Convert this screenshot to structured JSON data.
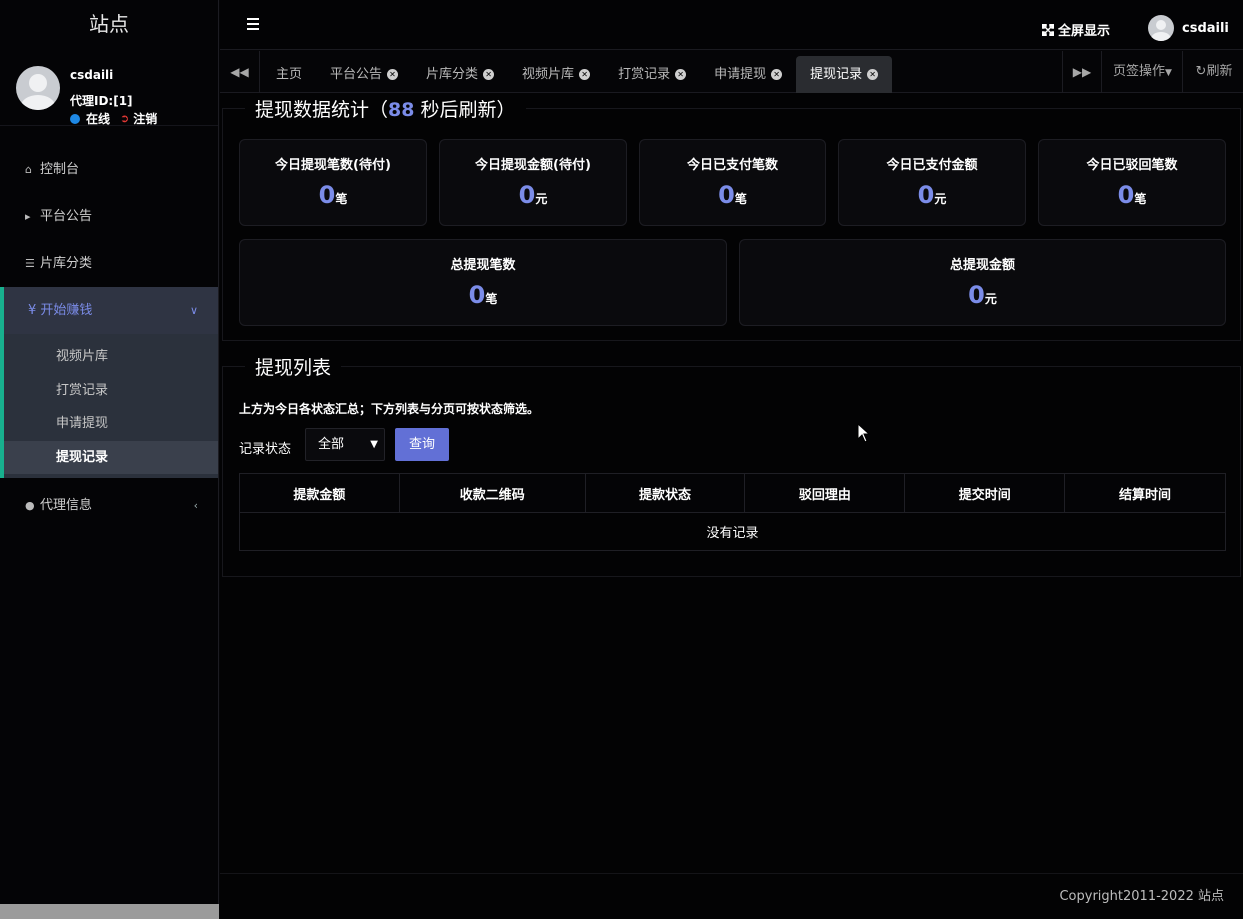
{
  "brand": "站点",
  "user": {
    "name": "csdaili",
    "agent_id": "代理ID:[1]",
    "online": "在线",
    "logout": "注销"
  },
  "sidebar": {
    "items": [
      {
        "label": "控制台",
        "icon": "home-icon"
      },
      {
        "label": "平台公告",
        "icon": "bullhorn-icon"
      },
      {
        "label": "片库分类",
        "icon": "list-icon"
      },
      {
        "label": "¥ 开始赚钱",
        "icon": "yen-icon"
      },
      {
        "label": "代理信息",
        "icon": "user-icon"
      }
    ],
    "submenu": [
      "视频片库",
      "打赏记录",
      "申请提现",
      "提现记录"
    ]
  },
  "topbar": {
    "fullscreen": "全屏显示",
    "username": "csdaili"
  },
  "tabs": {
    "items": [
      "主页",
      "平台公告",
      "片库分类",
      "视频片库",
      "打赏记录",
      "申请提现",
      "提现记录"
    ],
    "ops": "页签操作",
    "refresh": "刷新"
  },
  "stats": {
    "title_prefix": "提现数据统计（",
    "countdown": "88",
    "title_suffix": " 秒后刷新）",
    "cards": [
      {
        "label": "今日提现笔数(待付)",
        "value": "0",
        "unit": "笔"
      },
      {
        "label": "今日提现金额(待付)",
        "value": "0",
        "unit": "元"
      },
      {
        "label": "今日已支付笔数",
        "value": "0",
        "unit": "笔"
      },
      {
        "label": "今日已支付金额",
        "value": "0",
        "unit": "元"
      },
      {
        "label": "今日已驳回笔数",
        "value": "0",
        "unit": "笔"
      },
      {
        "label": "总提现笔数",
        "value": "0",
        "unit": "笔"
      },
      {
        "label": "总提现金额",
        "value": "0",
        "unit": "元"
      }
    ]
  },
  "list": {
    "title": "提现列表",
    "hint": "上方为今日各状态汇总；下方列表与分页可按状态筛选。",
    "filter_label": "记录状态",
    "filter_value": "全部",
    "query_button": "查询",
    "columns": [
      "提款金额",
      "收款二维码",
      "提款状态",
      "驳回理由",
      "提交时间",
      "结算时间"
    ],
    "empty": "没有记录"
  },
  "footer": {
    "copyright": "Copyright2011-2022 站点"
  },
  "colors": {
    "accent": "#7b8ce8",
    "button": "#6270d6",
    "online": "#1e88e5",
    "logout": "#e53935",
    "menu_bar": "#18b08e"
  }
}
